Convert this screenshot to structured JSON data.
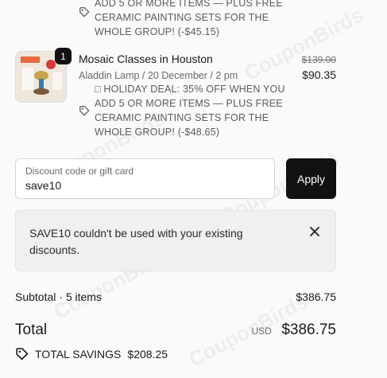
{
  "discounts": [
    {
      "lines": [
        "ADD 5 OR MORE ITEMS — PLUS FREE",
        "CERAMIC PAINTING SETS FOR THE",
        "WHOLE GROUP! (-$45.15)"
      ]
    },
    {
      "lines": [
        "□ HOLIDAY DEAL: 35% OFF WHEN YOU",
        "ADD 5 OR MORE ITEMS — PLUS FREE",
        "CERAMIC PAINTING SETS FOR THE",
        "WHOLE GROUP! (-$48.65)"
      ]
    }
  ],
  "item": {
    "quantity": "1",
    "title": "Mosaic Classes in Houston",
    "meta": "Aladdin Lamp / 20 December / 2 pm",
    "price_original": "$139.00",
    "price_discounted": "$90.35"
  },
  "discount_code": {
    "label": "Discount code or gift card",
    "value": "save10",
    "apply_label": "Apply"
  },
  "error": {
    "message": "SAVE10 couldn't be used with your existing discounts."
  },
  "summary": {
    "subtotal_label": "Subtotal · 5 items",
    "subtotal_value": "$386.75",
    "total_label": "Total",
    "currency": "USD",
    "total_value": "$386.75",
    "savings_label": "TOTAL SAVINGS",
    "savings_value": "$208.25"
  },
  "watermark": "CouponBirds"
}
